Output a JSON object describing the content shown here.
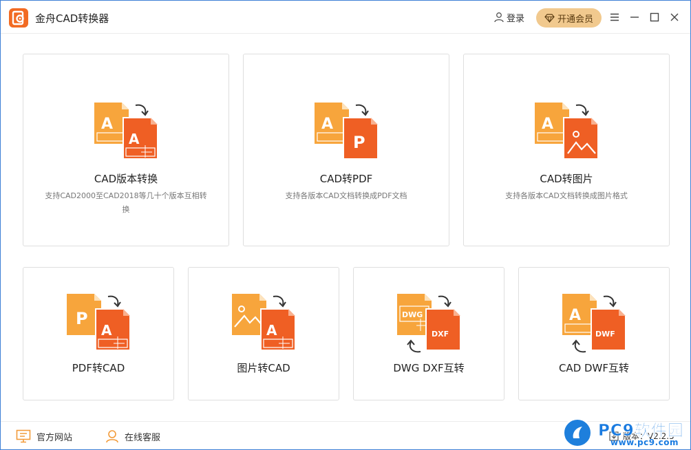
{
  "app": {
    "title": "金舟CAD转换器",
    "accent": "#f26b23",
    "vip_color": "#f1c98e"
  },
  "header": {
    "login_label": "登录",
    "vip_label": "开通会员"
  },
  "tools_large": [
    {
      "title": "CAD版本转换",
      "desc": "支持CAD2000至CAD2018等几十个版本互相转换",
      "icon": "cad-version-convert-icon"
    },
    {
      "title": "CAD转PDF",
      "desc": "支持各版本CAD文档转换成PDF文档",
      "icon": "cad-to-pdf-icon"
    },
    {
      "title": "CAD转图片",
      "desc": "支持各版本CAD文档转换成图片格式",
      "icon": "cad-to-image-icon"
    }
  ],
  "tools_small": [
    {
      "title": "PDF转CAD",
      "icon": "pdf-to-cad-icon"
    },
    {
      "title": "图片转CAD",
      "icon": "image-to-cad-icon"
    },
    {
      "title": "DWG DXF互转",
      "icon": "dwg-dxf-convert-icon"
    },
    {
      "title": "CAD DWF互转",
      "icon": "cad-dwf-convert-icon"
    }
  ],
  "footer": {
    "website_label": "官方网站",
    "service_label": "在线客服",
    "version_text": "版本：V2.2.5"
  },
  "watermark": {
    "brand": "PC9软件园",
    "url": "www.pc9.com"
  }
}
